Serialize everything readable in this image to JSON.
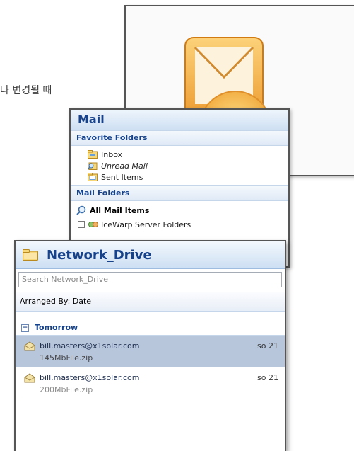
{
  "caption": "나 변경될 때",
  "mail_panel": {
    "title": "Mail",
    "favorite_folders_label": "Favorite Folders",
    "favorites": [
      {
        "label": "Inbox",
        "icon": "inbox-folder-icon"
      },
      {
        "label": "Unread Mail",
        "icon": "search-folder-icon"
      },
      {
        "label": "Sent Items",
        "icon": "sent-folder-icon"
      }
    ],
    "mail_folders_label": "Mail Folders",
    "all_mail_items_label": "All Mail Items",
    "tree_root_label": "IceWarp Server Folders"
  },
  "network_panel": {
    "title": "Network_Drive",
    "search_placeholder": "Search Network_Drive",
    "arranged_by": "Arranged By: Date",
    "group_label": "Tomorrow",
    "messages": [
      {
        "from": "bill.masters@x1solar.com",
        "attachment": "145MbFile.zip",
        "date": "so 21",
        "selected": true
      },
      {
        "from": "bill.masters@x1solar.com",
        "attachment": "200MbFile.zip",
        "date": "so 21",
        "selected": false
      }
    ]
  },
  "colors": {
    "accent": "#15428b",
    "selected_row": "#b8c6dc",
    "logo_orange": "#f0a830"
  }
}
